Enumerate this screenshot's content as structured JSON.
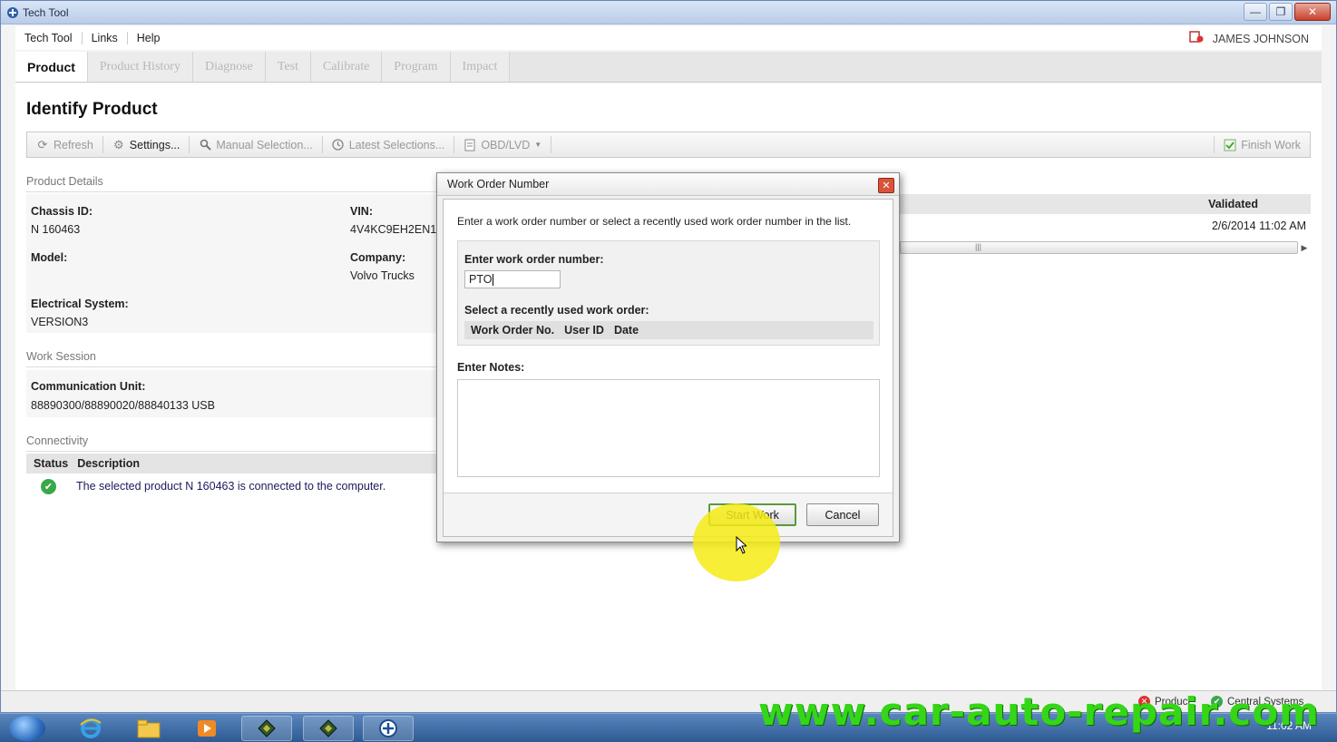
{
  "window": {
    "title": "Tech Tool"
  },
  "menu": {
    "items": [
      "Tech Tool",
      "Links",
      "Help"
    ],
    "user_name": "JAMES JOHNSON"
  },
  "tabs": [
    "Product",
    "Product History",
    "Diagnose",
    "Test",
    "Calibrate",
    "Program",
    "Impact"
  ],
  "page": {
    "title": "Identify Product"
  },
  "toolbar": {
    "refresh": "Refresh",
    "settings": "Settings...",
    "manual_selection": "Manual Selection...",
    "latest_selections": "Latest Selections...",
    "obd": "OBD/LVD",
    "finish_work": "Finish Work"
  },
  "product_details": {
    "header": "Product Details",
    "chassis_id_label": "Chassis ID:",
    "chassis_id": "N 160463",
    "vin_label": "VIN:",
    "vin": "4V4KC9EH2EN1",
    "model_label": "Model:",
    "model": "",
    "company_label": "Company:",
    "company": "Volvo Trucks",
    "electrical_label": "Electrical System:",
    "electrical": "VERSION3"
  },
  "work_session": {
    "header": "Work Session",
    "comm_unit_label": "Communication Unit:",
    "comm_unit": "88890300/88890020/88840133 USB"
  },
  "connectivity": {
    "header": "Connectivity",
    "col_status": "Status",
    "col_description": "Description",
    "row_description": "The selected product N 160463 is connected to the computer."
  },
  "validation": {
    "header": "Validated",
    "value": "2/6/2014 11:02 AM"
  },
  "status_bar": {
    "product": "Product",
    "central": "Central Systems"
  },
  "dialog": {
    "title": "Work Order Number",
    "instruction": "Enter a work order number or select a recently used work order number in the list.",
    "enter_label": "Enter work order number:",
    "work_order_value": "PTO",
    "recent_label": "Select a recently used work order:",
    "columns": [
      "Work Order No.",
      "User ID",
      "Date"
    ],
    "notes_label": "Enter Notes:",
    "start_button": "Start Work",
    "cancel_button": "Cancel"
  },
  "taskbar": {
    "time": "11:02 AM"
  },
  "watermark": "www.car-auto-repair.com",
  "colors": {
    "accent_green": "#3aa84a",
    "highlight_yellow": "#f5eb14",
    "watermark_green": "#35d617"
  }
}
